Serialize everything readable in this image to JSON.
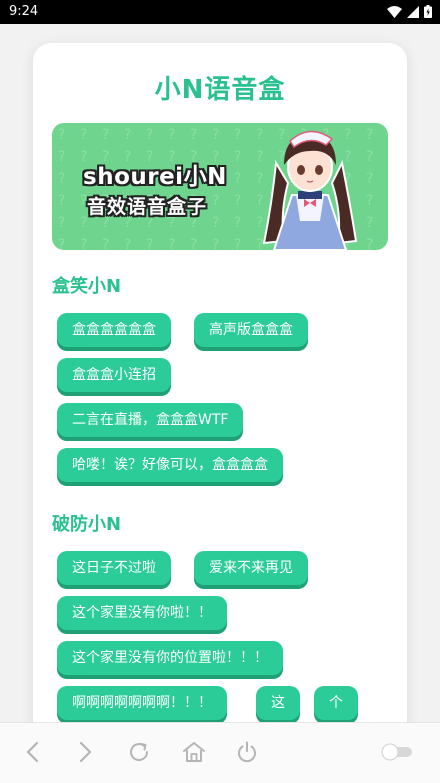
{
  "status": {
    "time": "9:24"
  },
  "app": {
    "title": "小N语音盒"
  },
  "banner": {
    "line1": "shourei小N",
    "line2": "音效语音盒子"
  },
  "sections": [
    {
      "title": "盒笑小N",
      "buttons": [
        "盒盒盒盒盒盒",
        "高声版盒盒盒",
        "盒盒盒小连招",
        "二言在直播，盒盒盒WTF",
        "哈喽！诶？好像可以，盒盒盒盒"
      ]
    },
    {
      "title": "破防小N",
      "buttons": [
        "这日子不过啦",
        "爱来不来再见",
        "这个家里没有你啦！！",
        "这个家里没有你的位置啦！！！",
        "啊啊啊啊啊啊啊！！！",
        "这",
        "个"
      ]
    }
  ],
  "nav": {
    "icons": [
      "back-icon",
      "forward-icon",
      "reload-icon",
      "home-icon",
      "power-icon",
      "toggle-switch"
    ]
  },
  "colors": {
    "accent": "#2bc18e",
    "button": "#2bcc97",
    "banner": "#6fd58e"
  }
}
